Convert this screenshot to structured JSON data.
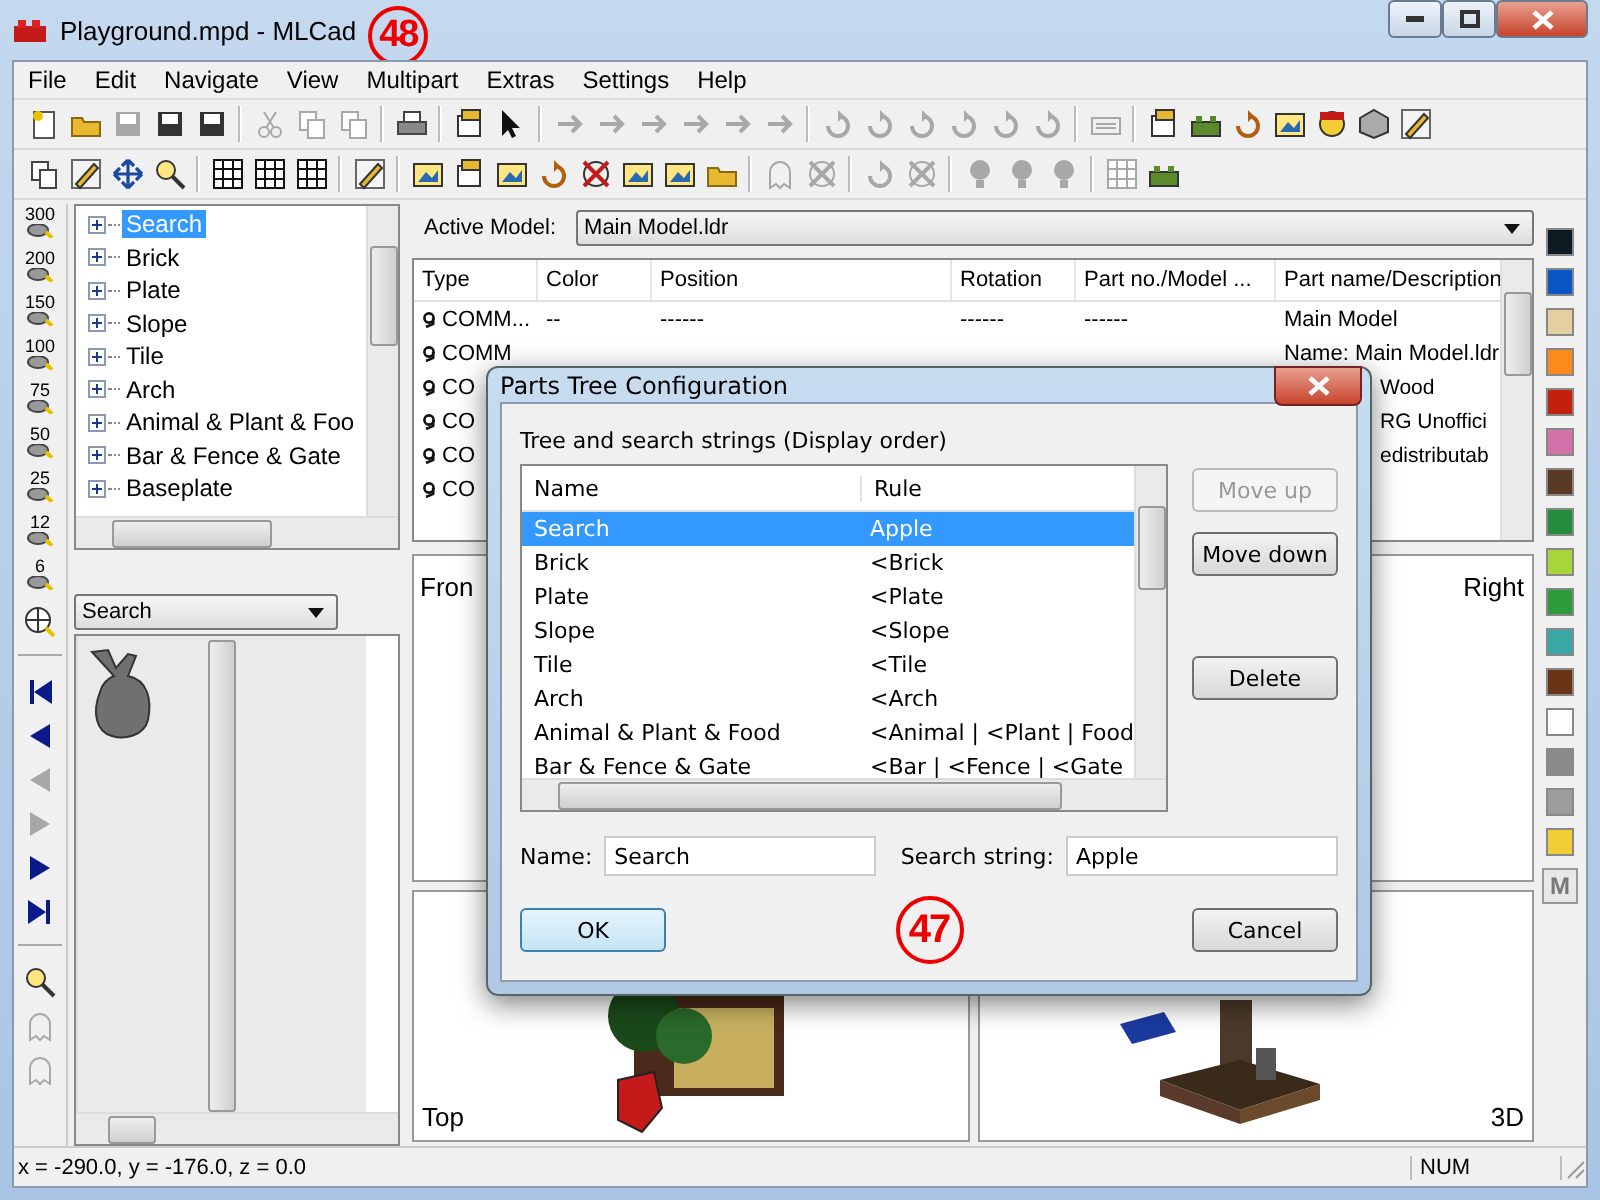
{
  "window": {
    "title": "Playground.mpd - MLCad",
    "callout": "48"
  },
  "menu": [
    "File",
    "Edit",
    "Navigate",
    "View",
    "Multipart",
    "Extras",
    "Settings",
    "Help"
  ],
  "zoom_levels": [
    "300",
    "200",
    "150",
    "100",
    "75",
    "50",
    "25",
    "12",
    "6"
  ],
  "parts_tree": [
    {
      "label": "Search",
      "selected": true,
      "expanded": false
    },
    {
      "label": "Brick",
      "selected": false,
      "expanded": false
    },
    {
      "label": "Plate",
      "selected": false,
      "expanded": false
    },
    {
      "label": "Slope",
      "selected": false,
      "expanded": false
    },
    {
      "label": "Tile",
      "selected": false,
      "expanded": false
    },
    {
      "label": "Arch",
      "selected": false,
      "expanded": false
    },
    {
      "label": "Animal & Plant & Foo",
      "selected": false,
      "expanded": false
    },
    {
      "label": "Bar & Fence & Gate",
      "selected": false,
      "expanded": false
    },
    {
      "label": "Baseplate",
      "selected": false,
      "expanded": false
    }
  ],
  "part_filter": {
    "value": "Search"
  },
  "active_model": {
    "label": "Active Model:",
    "value": "Main Model.ldr"
  },
  "table": {
    "columns": [
      "Type",
      "Color",
      "Position",
      "Rotation",
      "Part no./Model ...",
      "Part name/Description"
    ],
    "rows": [
      {
        "type": "COMM...",
        "color_text": "--",
        "position": "------",
        "rotation": "------",
        "part_no": "------",
        "description": "Main Model"
      },
      {
        "type": "COMM",
        "description": "Name: Main Model.ldr"
      },
      {
        "type": "CO",
        "description": "Wood"
      },
      {
        "type": "CO",
        "description": "RG Unoffici"
      },
      {
        "type": "CO",
        "description": "edistributab"
      },
      {
        "type": "CO"
      }
    ]
  },
  "viewports": [
    {
      "label": "Fron"
    },
    {
      "label": "Right"
    },
    {
      "label": "Top"
    },
    {
      "label": "3D"
    }
  ],
  "palette": [
    {
      "color": "#0d1a22"
    },
    {
      "color": "#0a55c4"
    },
    {
      "color": "#e4cfa0"
    },
    {
      "color": "#fb8b1c"
    },
    {
      "color": "#c4200e"
    },
    {
      "color": "#cf73a8"
    },
    {
      "color": "#5a3a24"
    },
    {
      "color": "#248c3c"
    },
    {
      "color": "#a6d63c"
    },
    {
      "color": "#2f9c3c"
    },
    {
      "color": "#3aa8a6"
    },
    {
      "color": "#6a3416"
    },
    {
      "color": "#ffffff"
    },
    {
      "color": "#8a8a8a"
    },
    {
      "color": "#9c9c9c"
    },
    {
      "color": "#f3cd36"
    }
  ],
  "palette_button": "M",
  "dialog": {
    "title": "Parts Tree Configuration",
    "group_label": "Tree and search strings (Display order)",
    "columns": [
      "Name",
      "Rule"
    ],
    "rows": [
      {
        "name": "Search",
        "rule": "Apple",
        "selected": true
      },
      {
        "name": "Brick",
        "rule": "<Brick",
        "selected": false
      },
      {
        "name": "Plate",
        "rule": "<Plate",
        "selected": false
      },
      {
        "name": "Slope",
        "rule": "<Slope",
        "selected": false
      },
      {
        "name": "Tile",
        "rule": "<Tile",
        "selected": false
      },
      {
        "name": "Arch",
        "rule": "<Arch",
        "selected": false
      },
      {
        "name": "Animal & Plant & Food",
        "rule": "<Animal | <Plant | Food",
        "selected": false
      },
      {
        "name": "Bar & Fence & Gate",
        "rule": "<Bar | <Fence | <Gate",
        "selected": false
      }
    ],
    "side_buttons": [
      {
        "label": "Move up",
        "disabled": true
      },
      {
        "label": "Move down",
        "disabled": false
      },
      {
        "label": "Delete",
        "disabled": false
      }
    ],
    "name_label": "Name:",
    "name_value": "Search",
    "search_label": "Search string:",
    "search_value": "Apple",
    "ok": "OK",
    "cancel": "Cancel",
    "callout": "47"
  },
  "status_bar": {
    "coords": "x = -290.0, y = -176.0, z = 0.0",
    "num": "NUM"
  }
}
